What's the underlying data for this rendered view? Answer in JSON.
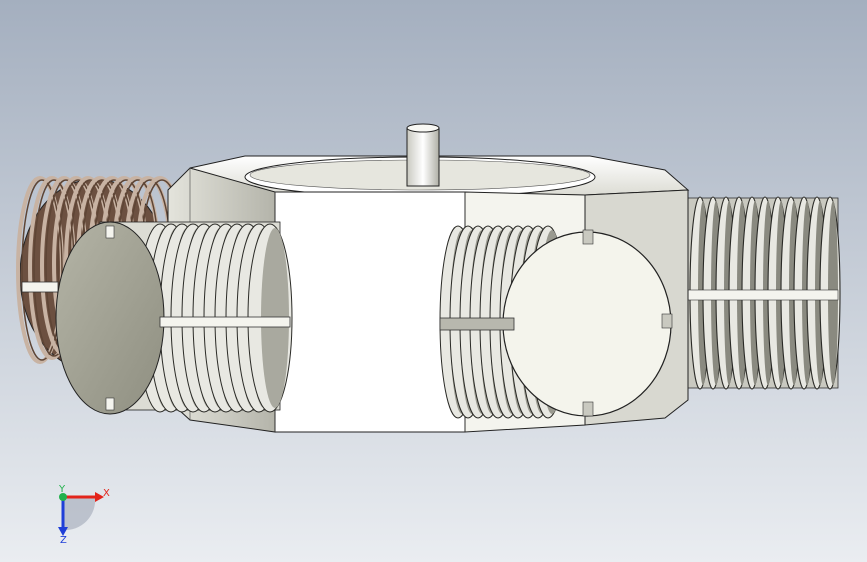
{
  "viewport": {
    "background_top": "#a4afbf",
    "background_bottom": "#eaedf1",
    "model": {
      "body_color": "#f2f2ee",
      "shade_color": "#c9c9c0",
      "thread_light": "#e8e8e2",
      "thread_dark": "#5a5a52",
      "copper_light": "#c8b3a3",
      "copper_dark": "#5e4535",
      "cap_color": "#9f9f91",
      "cap_face_light": "#f0f0e8"
    }
  },
  "triad": {
    "x_label": "X",
    "y_label": "Y",
    "z_label": "Z",
    "x_color": "#e3241b",
    "y_color": "#22b14c",
    "z_color": "#1f3fd8"
  }
}
